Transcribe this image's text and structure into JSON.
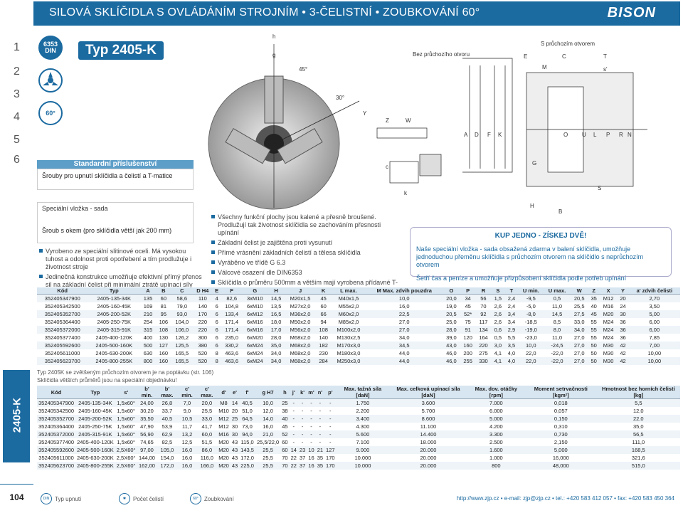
{
  "header": {
    "title": "SILOVÁ SKLÍČIDLA S OVLÁDÁNÍM STROJNÍM • 3-ČELISTNÍ • ZOUBKOVÁNÍ 60°",
    "logo": "BISON"
  },
  "sidebar": {
    "numbers": [
      "1",
      "2",
      "3",
      "4",
      "5",
      "6"
    ],
    "code": "2405-K",
    "page": "104"
  },
  "icons": {
    "din": "6353 DIN",
    "angle": "60°"
  },
  "product": {
    "type_label": "Typ 2405-K"
  },
  "accessories": {
    "title": "Standardní příslušenství",
    "item1": "Šrouby pro upnutí sklíčidla a čelistí a T-matice",
    "item2_title": "Speciální vložka - sada",
    "item2_text": "Šroub s okem (pro sklíčidla větší jak 200 mm)"
  },
  "features_left": [
    "Vyrobeno ze speciální slitinové oceli. Má vysokou tuhost a odolnost proti opotřebení a tím prodlužuje i životnost stroje",
    "Jedinečná konstrukce umožňuje efektivní přímý přenos sil na základní čelist při minimální ztrátě upínací síly"
  ],
  "features_right": [
    "Všechny funkční plochy jsou kalené a přesně broušené. Prodlužují tak životnost sklíčidla se zachováním přesnosti upínání",
    "Základní čelist je zajištěna proti vysunutí",
    "Přímé vrásnění základních čelistí a tělesa sklíčidla",
    "Vyráběno ve třídě G 6.3",
    "Válcové osazení dle DIN6353",
    "Sklíčidla o průměru 500mm a větším mají vyrobena přídavné T-drážky"
  ],
  "drawing": {
    "labels_chuck": [
      "h",
      "g",
      "45°",
      "30°",
      "Y",
      "c",
      "Z",
      "W",
      "m",
      "k"
    ],
    "caption_without": "Bez průchozího otvoru",
    "caption_with": "S průchozím otvorem",
    "labels_section": [
      "E",
      "C",
      "T",
      "M",
      "s'",
      "A",
      "D",
      "F",
      "K",
      "L",
      "U",
      "O",
      "P",
      "R",
      "N",
      "G",
      "H",
      "S",
      "B"
    ]
  },
  "promo": {
    "heading": "KUP JEDNO - ZÍSKEJ DVĚ!",
    "text1": "Naše speciální vložka - sada obsažená zdarma v balení sklíčidla, umožňuje jednoduchou přeměnu sklíčidla s průchozím otvorem na sklíčidlo s neprůchozím otvorem",
    "text2": "Šetří čas a peníze a umožňuje přizpůsobení sklíčidla podle potřeb upínání"
  },
  "table1": {
    "headers": [
      "Kód",
      "Typ",
      "A",
      "B",
      "C",
      "D H4",
      "E",
      "F",
      "G",
      "H",
      "J",
      "K",
      "L max.",
      "M Max. zdvih pouzdra",
      "O",
      "P",
      "R",
      "S",
      "T",
      "U min.",
      "U max.",
      "W",
      "Z",
      "X",
      "Y",
      "a' zdvih čelisti"
    ],
    "rows": [
      [
        "352405347900",
        "2405-135-34K",
        "135",
        "60",
        "58,6",
        "110",
        "4",
        "82,6",
        "3xM10",
        "14,5",
        "M20x1,5",
        "45",
        "M40x1,5",
        "10,0",
        "20,0",
        "34",
        "56",
        "1,5",
        "2,4",
        "-9,5",
        "0,5",
        "20,5",
        "35",
        "M12",
        "20",
        "2,70"
      ],
      [
        "352405342500",
        "2405-160-45K",
        "169",
        "81",
        "79,0",
        "140",
        "6",
        "104,8",
        "6xM10",
        "13,5",
        "M27x2,0",
        "60",
        "M55x2,0",
        "16,0",
        "19,0",
        "45",
        "70",
        "2,6",
        "2,4",
        "-5,0",
        "11,0",
        "25,5",
        "40",
        "M16",
        "24",
        "3,50"
      ],
      [
        "352405352700",
        "2405-200-52K",
        "210",
        "95",
        "93,0",
        "170",
        "6",
        "133,4",
        "6xM12",
        "16,5",
        "M36x2,0",
        "66",
        "M60x2,0",
        "22,5",
        "20,5",
        "52*",
        "92",
        "2,6",
        "3,4",
        "-8,0",
        "14,5",
        "27,5",
        "45",
        "M20",
        "30",
        "5,00"
      ],
      [
        "352405364400",
        "2405-250-75K",
        "254",
        "106",
        "104,0",
        "220",
        "6",
        "171,4",
        "6xM16",
        "18,0",
        "M50x2,0",
        "94",
        "M85x2,0",
        "27,0",
        "25,0",
        "75",
        "117",
        "2,6",
        "3,4",
        "-18,5",
        "8,5",
        "33,0",
        "55",
        "M24",
        "36",
        "6,00"
      ],
      [
        "352405372000",
        "2405-315-91K",
        "315",
        "108",
        "106,0",
        "220",
        "6",
        "171,4",
        "6xM16",
        "17,0",
        "M56x2,0",
        "108",
        "M100x2,0",
        "27,0",
        "28,0",
        "91",
        "134",
        "0,6",
        "2,9",
        "-19,0",
        "8,0",
        "34,0",
        "55",
        "M24",
        "36",
        "6,00"
      ],
      [
        "352405377400",
        "2405-400-120K",
        "400",
        "130",
        "126,2",
        "300",
        "6",
        "235,0",
        "6xM20",
        "28,0",
        "M68x2,0",
        "140",
        "M130x2,5",
        "34,0",
        "39,0",
        "120",
        "164",
        "0,5",
        "5,5",
        "-23,0",
        "11,0",
        "27,0",
        "55",
        "M24",
        "36",
        "7,85"
      ],
      [
        "352405592600",
        "2405-500-160K",
        "500",
        "127",
        "125,5",
        "380",
        "6",
        "330,2",
        "6xM24",
        "35,0",
        "M68x2,0",
        "182",
        "M170x3,0",
        "34,5",
        "43,0",
        "160",
        "220",
        "3,0",
        "3,5",
        "10,0",
        "-24,5",
        "27,0",
        "50",
        "M30",
        "42",
        "7,00"
      ],
      [
        "352405611000",
        "2405-630-200K",
        "630",
        "160",
        "165,5",
        "520",
        "8",
        "463,6",
        "6xM24",
        "34,0",
        "M68x2,0",
        "230",
        "M180x3,0",
        "44,0",
        "46,0",
        "200",
        "275",
        "4,1",
        "4,0",
        "22,0",
        "-22,0",
        "27,0",
        "50",
        "M30",
        "42",
        "10,00"
      ],
      [
        "352405623700",
        "2405-800-255K",
        "800",
        "160",
        "165,5",
        "520",
        "8",
        "463,6",
        "6xM24",
        "34,0",
        "M68x2,0",
        "284",
        "M250x3,0",
        "44,0",
        "46,0",
        "255",
        "330",
        "4,1",
        "4,0",
        "22,0",
        "-22,0",
        "27,0",
        "50",
        "M30",
        "42",
        "10,00"
      ]
    ]
  },
  "notes": {
    "note1": "Typ 2405K se zvětšeným průchozím otvorem je na poptávku (str. 106)",
    "note2": "Sklíčidla větších průměrů jsou na speciální objednávku!"
  },
  "table2": {
    "headers": [
      "Kód",
      "Typ",
      "s'",
      "b' min.",
      "b' max.",
      "c' min.",
      "c' max.",
      "d'",
      "e'",
      "f'",
      "g H7",
      "h",
      "j'",
      "k'",
      "m'",
      "n'",
      "p'",
      "Max. tažná síla [daN]",
      "Max. celková upínací síla [daN]",
      "Max. dov. otáčky [rpm]",
      "Moment setrvačnosti [kgm²]",
      "Hmotnost bez horních čelistí [kg]"
    ],
    "rows": [
      [
        "352405347900",
        "2405-135-34K",
        "1,5x60°",
        "24,00",
        "26,8",
        "7,0",
        "20,0",
        "M8",
        "14",
        "40,5",
        "10,0",
        "25",
        "-",
        "-",
        "-",
        "-",
        "-",
        "1.750",
        "3.600",
        "7.000",
        "0,018",
        "5,5"
      ],
      [
        "352405342500",
        "2405-160-45K",
        "1,5x60°",
        "30,20",
        "33,7",
        "9,0",
        "25,5",
        "M10",
        "20",
        "51,0",
        "12,0",
        "38",
        "-",
        "-",
        "-",
        "-",
        "-",
        "2.200",
        "5.700",
        "6.000",
        "0,057",
        "12,0"
      ],
      [
        "352405352700",
        "2405-200-52K",
        "1,5x60°",
        "35,50",
        "40,5",
        "10,5",
        "33,0",
        "M12",
        "25",
        "64,5",
        "14,0",
        "40",
        "-",
        "-",
        "-",
        "-",
        "-",
        "3.400",
        "8.600",
        "5.000",
        "0,150",
        "22,0"
      ],
      [
        "352405364400",
        "2405-250-75K",
        "1,5x60°",
        "47,90",
        "53,9",
        "11,7",
        "41,7",
        "M12",
        "30",
        "73,0",
        "16,0",
        "45",
        "-",
        "-",
        "-",
        "-",
        "-",
        "4.300",
        "11.100",
        "4.200",
        "0,310",
        "35,0"
      ],
      [
        "352405372000",
        "2405-315-91K",
        "1,5x60°",
        "56,90",
        "62,9",
        "13,2",
        "60,0",
        "M16",
        "30",
        "94,0",
        "21,0",
        "52",
        "-",
        "-",
        "-",
        "-",
        "-",
        "5.600",
        "14.400",
        "3.300",
        "0,730",
        "56,5"
      ],
      [
        "352405377400",
        "2405-400-120K",
        "1,5x60°",
        "74,65",
        "82,5",
        "12,5",
        "51,5",
        "M20",
        "43",
        "115,0",
        "25,5/22,0",
        "60",
        "-",
        "-",
        "-",
        "-",
        "-",
        "7.100",
        "18.000",
        "2.500",
        "2,150",
        "111,0"
      ],
      [
        "352405592600",
        "2405-500-160K",
        "2,5X60°",
        "97,00",
        "105,0",
        "16,0",
        "86,0",
        "M20",
        "43",
        "143,5",
        "25,5",
        "60",
        "14",
        "23",
        "10",
        "21",
        "127",
        "9.000",
        "20.000",
        "1.600",
        "5,000",
        "168,5"
      ],
      [
        "352405611000",
        "2405-630-200K",
        "2,5X60°",
        "144,00",
        "154,0",
        "16,0",
        "116,0",
        "M20",
        "43",
        "172,0",
        "25,5",
        "70",
        "22",
        "37",
        "16",
        "35",
        "170",
        "10.000",
        "20.000",
        "1.000",
        "16,000",
        "321,6"
      ],
      [
        "352405623700",
        "2405-800-255K",
        "2,5X60°",
        "162,00",
        "172,0",
        "16,0",
        "166,0",
        "M20",
        "43",
        "225,0",
        "25,5",
        "70",
        "22",
        "37",
        "16",
        "35",
        "170",
        "10.000",
        "20.000",
        "800",
        "48,000",
        "515,0"
      ]
    ]
  },
  "footer": {
    "item1": "Typ upnutí",
    "item2": "Počet čelistí",
    "item3": "Zoubkování",
    "contact": "http://www.zjp.cz  •  e-mail: zjp@zjp.cz  •  tel.: +420 583 412 057  •  fax: +420 583 450 364"
  }
}
